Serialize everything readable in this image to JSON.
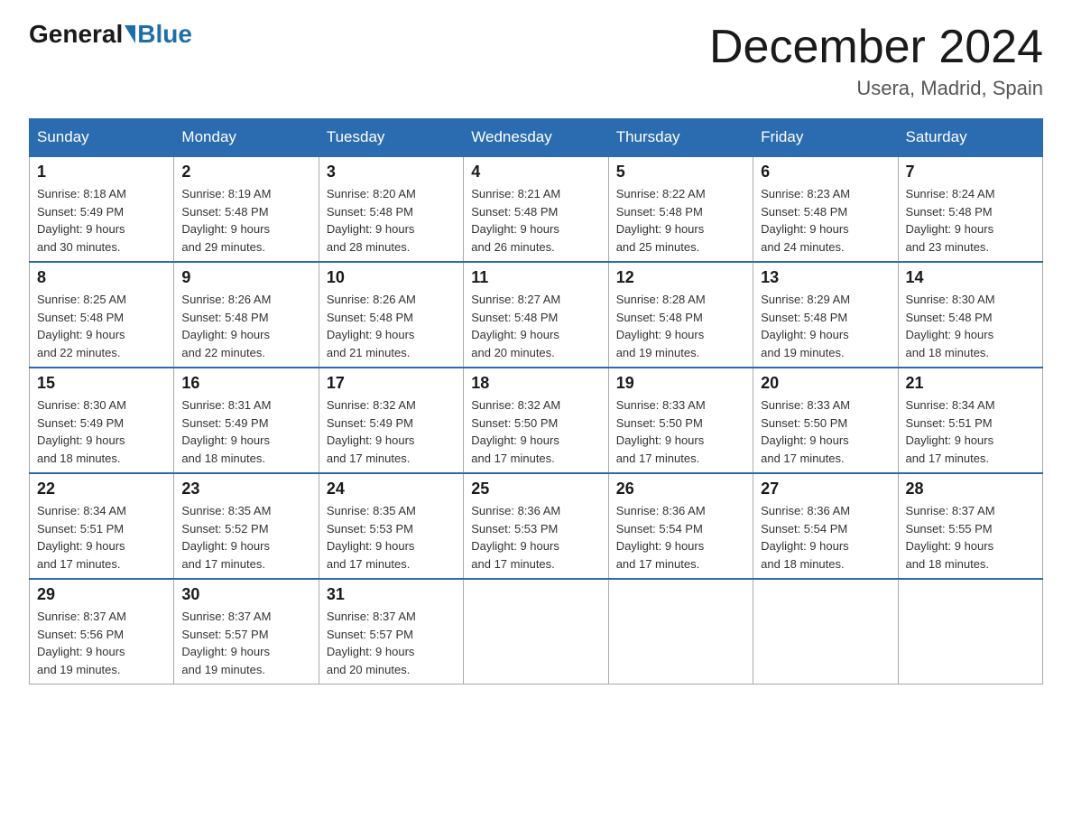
{
  "header": {
    "logo_general": "General",
    "logo_blue": "Blue",
    "title": "December 2024",
    "subtitle": "Usera, Madrid, Spain"
  },
  "days_of_week": [
    "Sunday",
    "Monday",
    "Tuesday",
    "Wednesday",
    "Thursday",
    "Friday",
    "Saturday"
  ],
  "weeks": [
    [
      {
        "day": "1",
        "sunrise": "8:18 AM",
        "sunset": "5:49 PM",
        "daylight": "9 hours and 30 minutes."
      },
      {
        "day": "2",
        "sunrise": "8:19 AM",
        "sunset": "5:48 PM",
        "daylight": "9 hours and 29 minutes."
      },
      {
        "day": "3",
        "sunrise": "8:20 AM",
        "sunset": "5:48 PM",
        "daylight": "9 hours and 28 minutes."
      },
      {
        "day": "4",
        "sunrise": "8:21 AM",
        "sunset": "5:48 PM",
        "daylight": "9 hours and 26 minutes."
      },
      {
        "day": "5",
        "sunrise": "8:22 AM",
        "sunset": "5:48 PM",
        "daylight": "9 hours and 25 minutes."
      },
      {
        "day": "6",
        "sunrise": "8:23 AM",
        "sunset": "5:48 PM",
        "daylight": "9 hours and 24 minutes."
      },
      {
        "day": "7",
        "sunrise": "8:24 AM",
        "sunset": "5:48 PM",
        "daylight": "9 hours and 23 minutes."
      }
    ],
    [
      {
        "day": "8",
        "sunrise": "8:25 AM",
        "sunset": "5:48 PM",
        "daylight": "9 hours and 22 minutes."
      },
      {
        "day": "9",
        "sunrise": "8:26 AM",
        "sunset": "5:48 PM",
        "daylight": "9 hours and 22 minutes."
      },
      {
        "day": "10",
        "sunrise": "8:26 AM",
        "sunset": "5:48 PM",
        "daylight": "9 hours and 21 minutes."
      },
      {
        "day": "11",
        "sunrise": "8:27 AM",
        "sunset": "5:48 PM",
        "daylight": "9 hours and 20 minutes."
      },
      {
        "day": "12",
        "sunrise": "8:28 AM",
        "sunset": "5:48 PM",
        "daylight": "9 hours and 19 minutes."
      },
      {
        "day": "13",
        "sunrise": "8:29 AM",
        "sunset": "5:48 PM",
        "daylight": "9 hours and 19 minutes."
      },
      {
        "day": "14",
        "sunrise": "8:30 AM",
        "sunset": "5:48 PM",
        "daylight": "9 hours and 18 minutes."
      }
    ],
    [
      {
        "day": "15",
        "sunrise": "8:30 AM",
        "sunset": "5:49 PM",
        "daylight": "9 hours and 18 minutes."
      },
      {
        "day": "16",
        "sunrise": "8:31 AM",
        "sunset": "5:49 PM",
        "daylight": "9 hours and 18 minutes."
      },
      {
        "day": "17",
        "sunrise": "8:32 AM",
        "sunset": "5:49 PM",
        "daylight": "9 hours and 17 minutes."
      },
      {
        "day": "18",
        "sunrise": "8:32 AM",
        "sunset": "5:50 PM",
        "daylight": "9 hours and 17 minutes."
      },
      {
        "day": "19",
        "sunrise": "8:33 AM",
        "sunset": "5:50 PM",
        "daylight": "9 hours and 17 minutes."
      },
      {
        "day": "20",
        "sunrise": "8:33 AM",
        "sunset": "5:50 PM",
        "daylight": "9 hours and 17 minutes."
      },
      {
        "day": "21",
        "sunrise": "8:34 AM",
        "sunset": "5:51 PM",
        "daylight": "9 hours and 17 minutes."
      }
    ],
    [
      {
        "day": "22",
        "sunrise": "8:34 AM",
        "sunset": "5:51 PM",
        "daylight": "9 hours and 17 minutes."
      },
      {
        "day": "23",
        "sunrise": "8:35 AM",
        "sunset": "5:52 PM",
        "daylight": "9 hours and 17 minutes."
      },
      {
        "day": "24",
        "sunrise": "8:35 AM",
        "sunset": "5:53 PM",
        "daylight": "9 hours and 17 minutes."
      },
      {
        "day": "25",
        "sunrise": "8:36 AM",
        "sunset": "5:53 PM",
        "daylight": "9 hours and 17 minutes."
      },
      {
        "day": "26",
        "sunrise": "8:36 AM",
        "sunset": "5:54 PM",
        "daylight": "9 hours and 17 minutes."
      },
      {
        "day": "27",
        "sunrise": "8:36 AM",
        "sunset": "5:54 PM",
        "daylight": "9 hours and 18 minutes."
      },
      {
        "day": "28",
        "sunrise": "8:37 AM",
        "sunset": "5:55 PM",
        "daylight": "9 hours and 18 minutes."
      }
    ],
    [
      {
        "day": "29",
        "sunrise": "8:37 AM",
        "sunset": "5:56 PM",
        "daylight": "9 hours and 19 minutes."
      },
      {
        "day": "30",
        "sunrise": "8:37 AM",
        "sunset": "5:57 PM",
        "daylight": "9 hours and 19 minutes."
      },
      {
        "day": "31",
        "sunrise": "8:37 AM",
        "sunset": "5:57 PM",
        "daylight": "9 hours and 20 minutes."
      },
      null,
      null,
      null,
      null
    ]
  ],
  "labels": {
    "sunrise_prefix": "Sunrise: ",
    "sunset_prefix": "Sunset: ",
    "daylight_prefix": "Daylight: "
  }
}
